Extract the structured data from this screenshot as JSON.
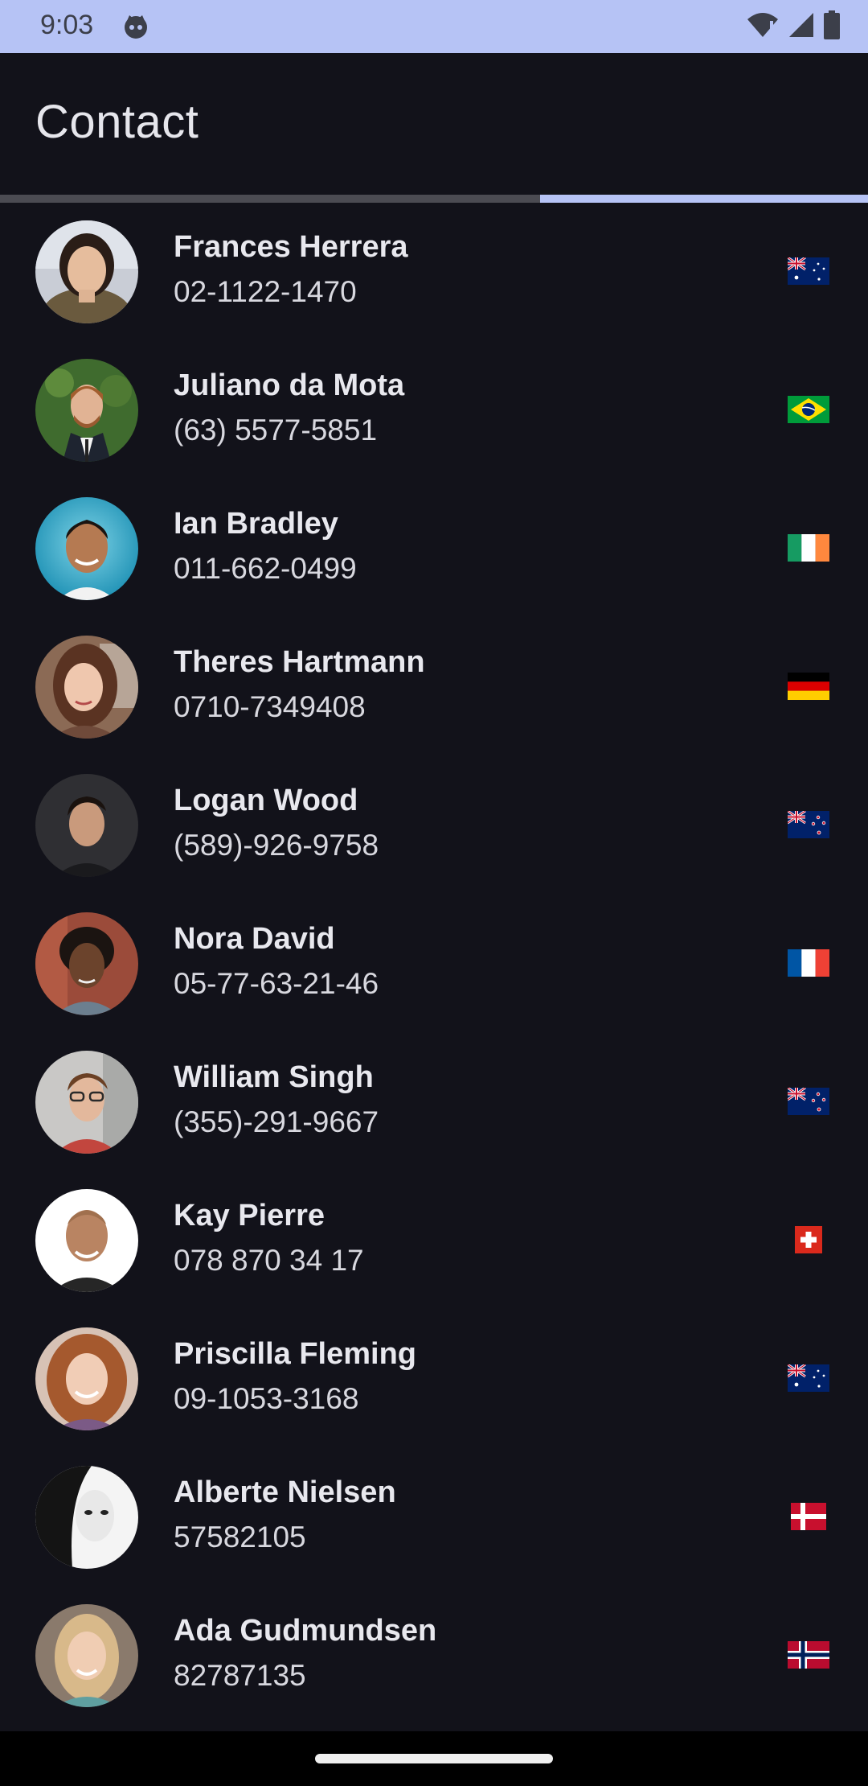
{
  "status_bar": {
    "time": "9:03",
    "background": "#b6c3f5",
    "icons": [
      "app-status-icon",
      "wifi-alert-icon",
      "cellular-signal-icon",
      "battery-icon"
    ]
  },
  "app_bar": {
    "title": "Contact"
  },
  "progress": {
    "fraction_start": 0.622,
    "fraction_end": 1.0,
    "track_color": "#4b4b52",
    "indicator_color": "#b6c3f5"
  },
  "contacts": [
    {
      "name": "Frances Herrera",
      "phone": "02-1122-1470",
      "flag": "australia-flag",
      "country": "AU"
    },
    {
      "name": "Juliano da Mota",
      "phone": "(63) 5577-5851",
      "flag": "brazil-flag",
      "country": "BR"
    },
    {
      "name": "Ian Bradley",
      "phone": "011-662-0499",
      "flag": "ireland-flag",
      "country": "IE"
    },
    {
      "name": "Theres Hartmann",
      "phone": "0710-7349408",
      "flag": "germany-flag",
      "country": "DE"
    },
    {
      "name": "Logan Wood",
      "phone": "(589)-926-9758",
      "flag": "new-zealand-flag",
      "country": "NZ"
    },
    {
      "name": "Nora David",
      "phone": "05-77-63-21-46",
      "flag": "france-flag",
      "country": "FR"
    },
    {
      "name": "William Singh",
      "phone": "(355)-291-9667",
      "flag": "new-zealand-flag",
      "country": "NZ"
    },
    {
      "name": "Kay Pierre",
      "phone": "078 870 34 17",
      "flag": "switzerland-flag",
      "country": "CH"
    },
    {
      "name": "Priscilla Fleming",
      "phone": "09-1053-3168",
      "flag": "australia-flag",
      "country": "AU"
    },
    {
      "name": "Alberte Nielsen",
      "phone": "57582105",
      "flag": "denmark-flag",
      "country": "DK"
    },
    {
      "name": "Ada Gudmundsen",
      "phone": "82787135",
      "flag": "norway-flag",
      "country": "NO"
    }
  ],
  "nav_bar": {
    "handle": "gesture-handle"
  },
  "colors": {
    "background": "#12121a",
    "title_text": "#e6e6ec",
    "name_text": "#e8e8ee",
    "phone_text": "#d8d8df"
  }
}
